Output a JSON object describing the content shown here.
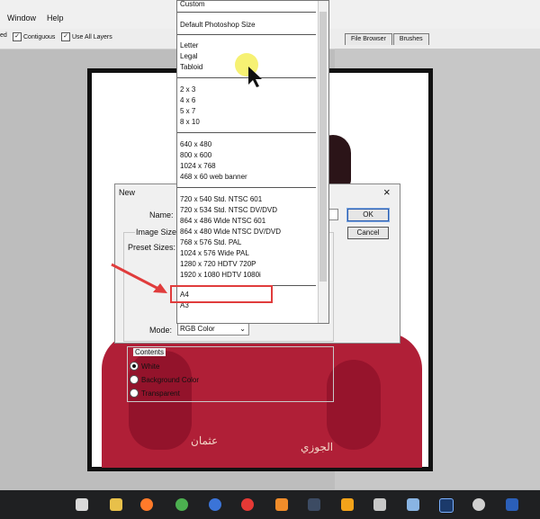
{
  "menubar": {
    "items": [
      "Window",
      "Help"
    ]
  },
  "options": [
    {
      "label": "ed",
      "checked": false
    },
    {
      "label": "Contiguous",
      "checked": true
    },
    {
      "label": "Use All Layers",
      "checked": true
    }
  ],
  "panel_tabs": [
    "File Browser",
    "Brushes"
  ],
  "dialog": {
    "title": "New",
    "name_label": "Name:",
    "image_size_label": "Image Size:",
    "preset_label": "Preset Sizes:",
    "mode_label": "Mode:",
    "mode_value": "RGB Color",
    "ok_label": "OK",
    "cancel_label": "Cancel",
    "close_glyph": "×",
    "contents": {
      "legend": "Contents",
      "options": [
        "White",
        "Background Color",
        "Transparent"
      ],
      "selected": "White"
    }
  },
  "preset_list": {
    "groups": [
      [
        "Custom"
      ],
      [
        "Default Photoshop Size"
      ],
      [
        "Letter",
        "Legal",
        "Tabloid"
      ],
      [
        "2 x 3",
        "4 x 6",
        "5 x 7",
        "8 x 10"
      ],
      [
        "640 x 480",
        "800 x 600",
        "1024 x 768",
        "468 x 60 web banner"
      ],
      [
        "720 x 540 Std. NTSC 601",
        "720 x 534 Std. NTSC DV/DVD",
        "864 x 486 Wide NTSC 601",
        "864 x 480 Wide NTSC DV/DVD",
        "768 x 576 Std. PAL",
        "1024 x 576 Wide PAL",
        "1280 x 720 HDTV 720P",
        "1920 x 1080 HDTV 1080i"
      ],
      [
        "A4",
        "A3"
      ]
    ],
    "highlighted": "A4"
  },
  "embroidery": [
    "عثمان",
    "الجوزي"
  ],
  "colors": {
    "highlight": "#e03c3c",
    "arrow": "#e03c3c",
    "cursor_halo": "#f5ef5a"
  },
  "taskbar": {
    "icons": [
      "anydesk-icon",
      "file-explorer-icon",
      "firefox-icon",
      "chrome-icon",
      "browser-icon",
      "opera-icon",
      "media-player-icon",
      "video-editor-icon",
      "media-icon",
      "photo-icon",
      "chat-icon",
      "photoshop-icon",
      "network-icon",
      "word-icon"
    ]
  }
}
